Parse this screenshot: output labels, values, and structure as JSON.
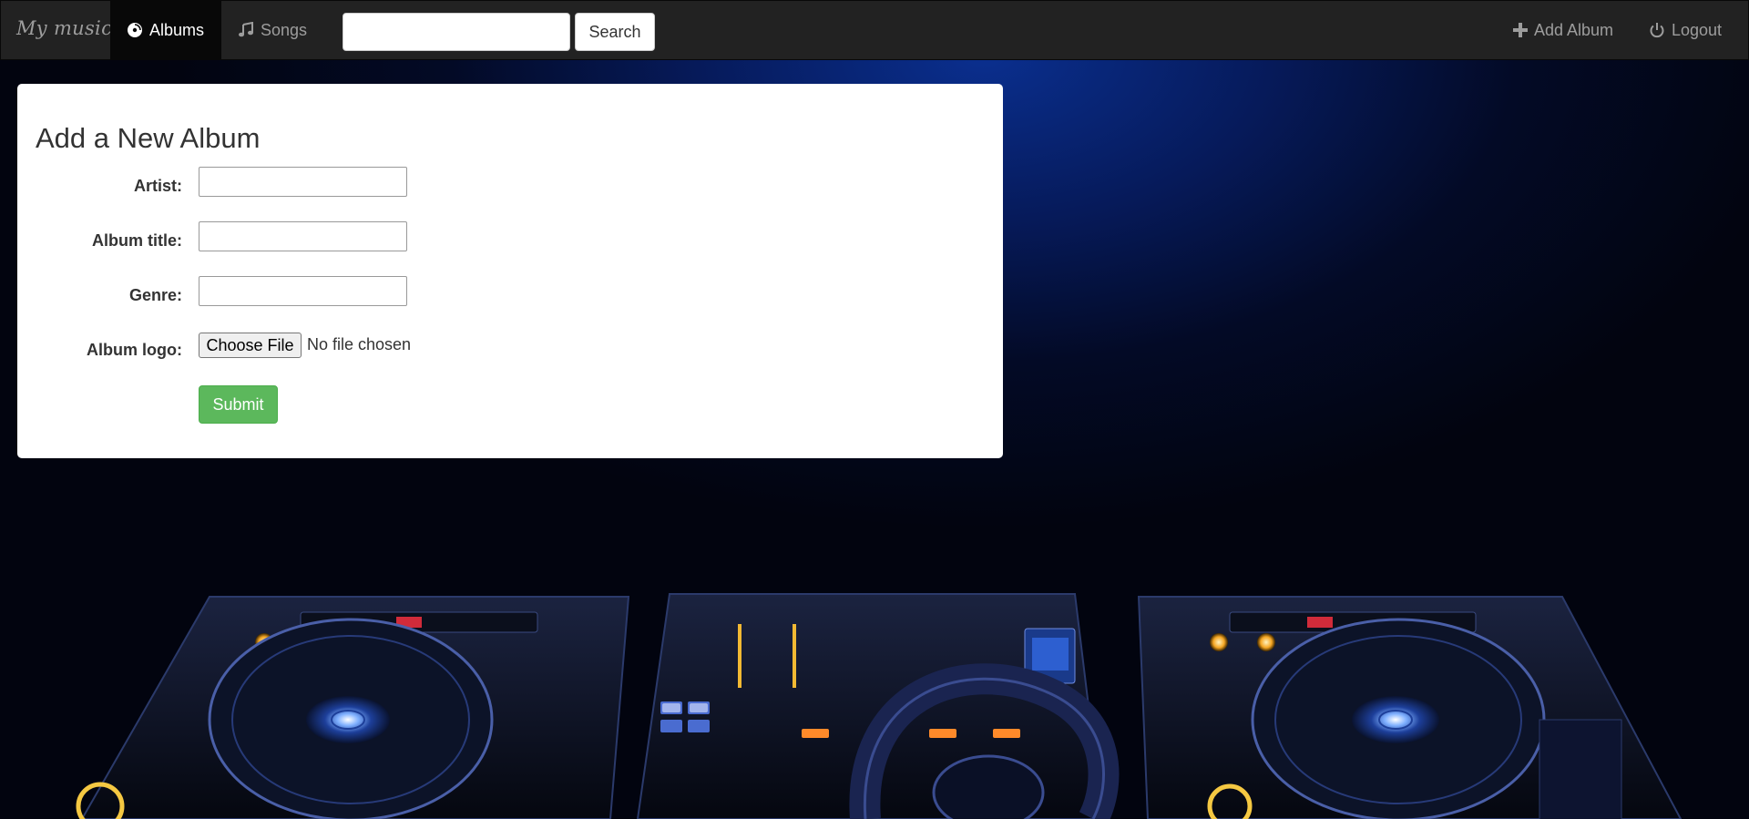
{
  "navbar": {
    "brand": "My music",
    "albums_label": "Albums",
    "songs_label": "Songs",
    "search_placeholder": "",
    "search_value": "",
    "search_button_label": "Search",
    "add_album_label": "Add Album",
    "logout_label": "Logout",
    "active_tab": "Albums"
  },
  "form": {
    "title": "Add a New Album",
    "artist_label": "Artist:",
    "artist_value": "",
    "album_title_label": "Album title:",
    "album_title_value": "",
    "genre_label": "Genre:",
    "genre_value": "",
    "album_logo_label": "Album logo:",
    "file_button_label": "Choose File",
    "file_status": "No file chosen",
    "submit_label": "Submit"
  },
  "colors": {
    "navbar_bg": "#222222",
    "navbar_text": "#9d9d9d",
    "active_tab_bg": "#080808",
    "submit_green": "#5cb85c",
    "background_blue": "#0a2f8f"
  },
  "icons": {
    "albums": "disc-icon",
    "songs": "music-note-icon",
    "add_album": "plus-icon",
    "logout": "power-icon"
  }
}
